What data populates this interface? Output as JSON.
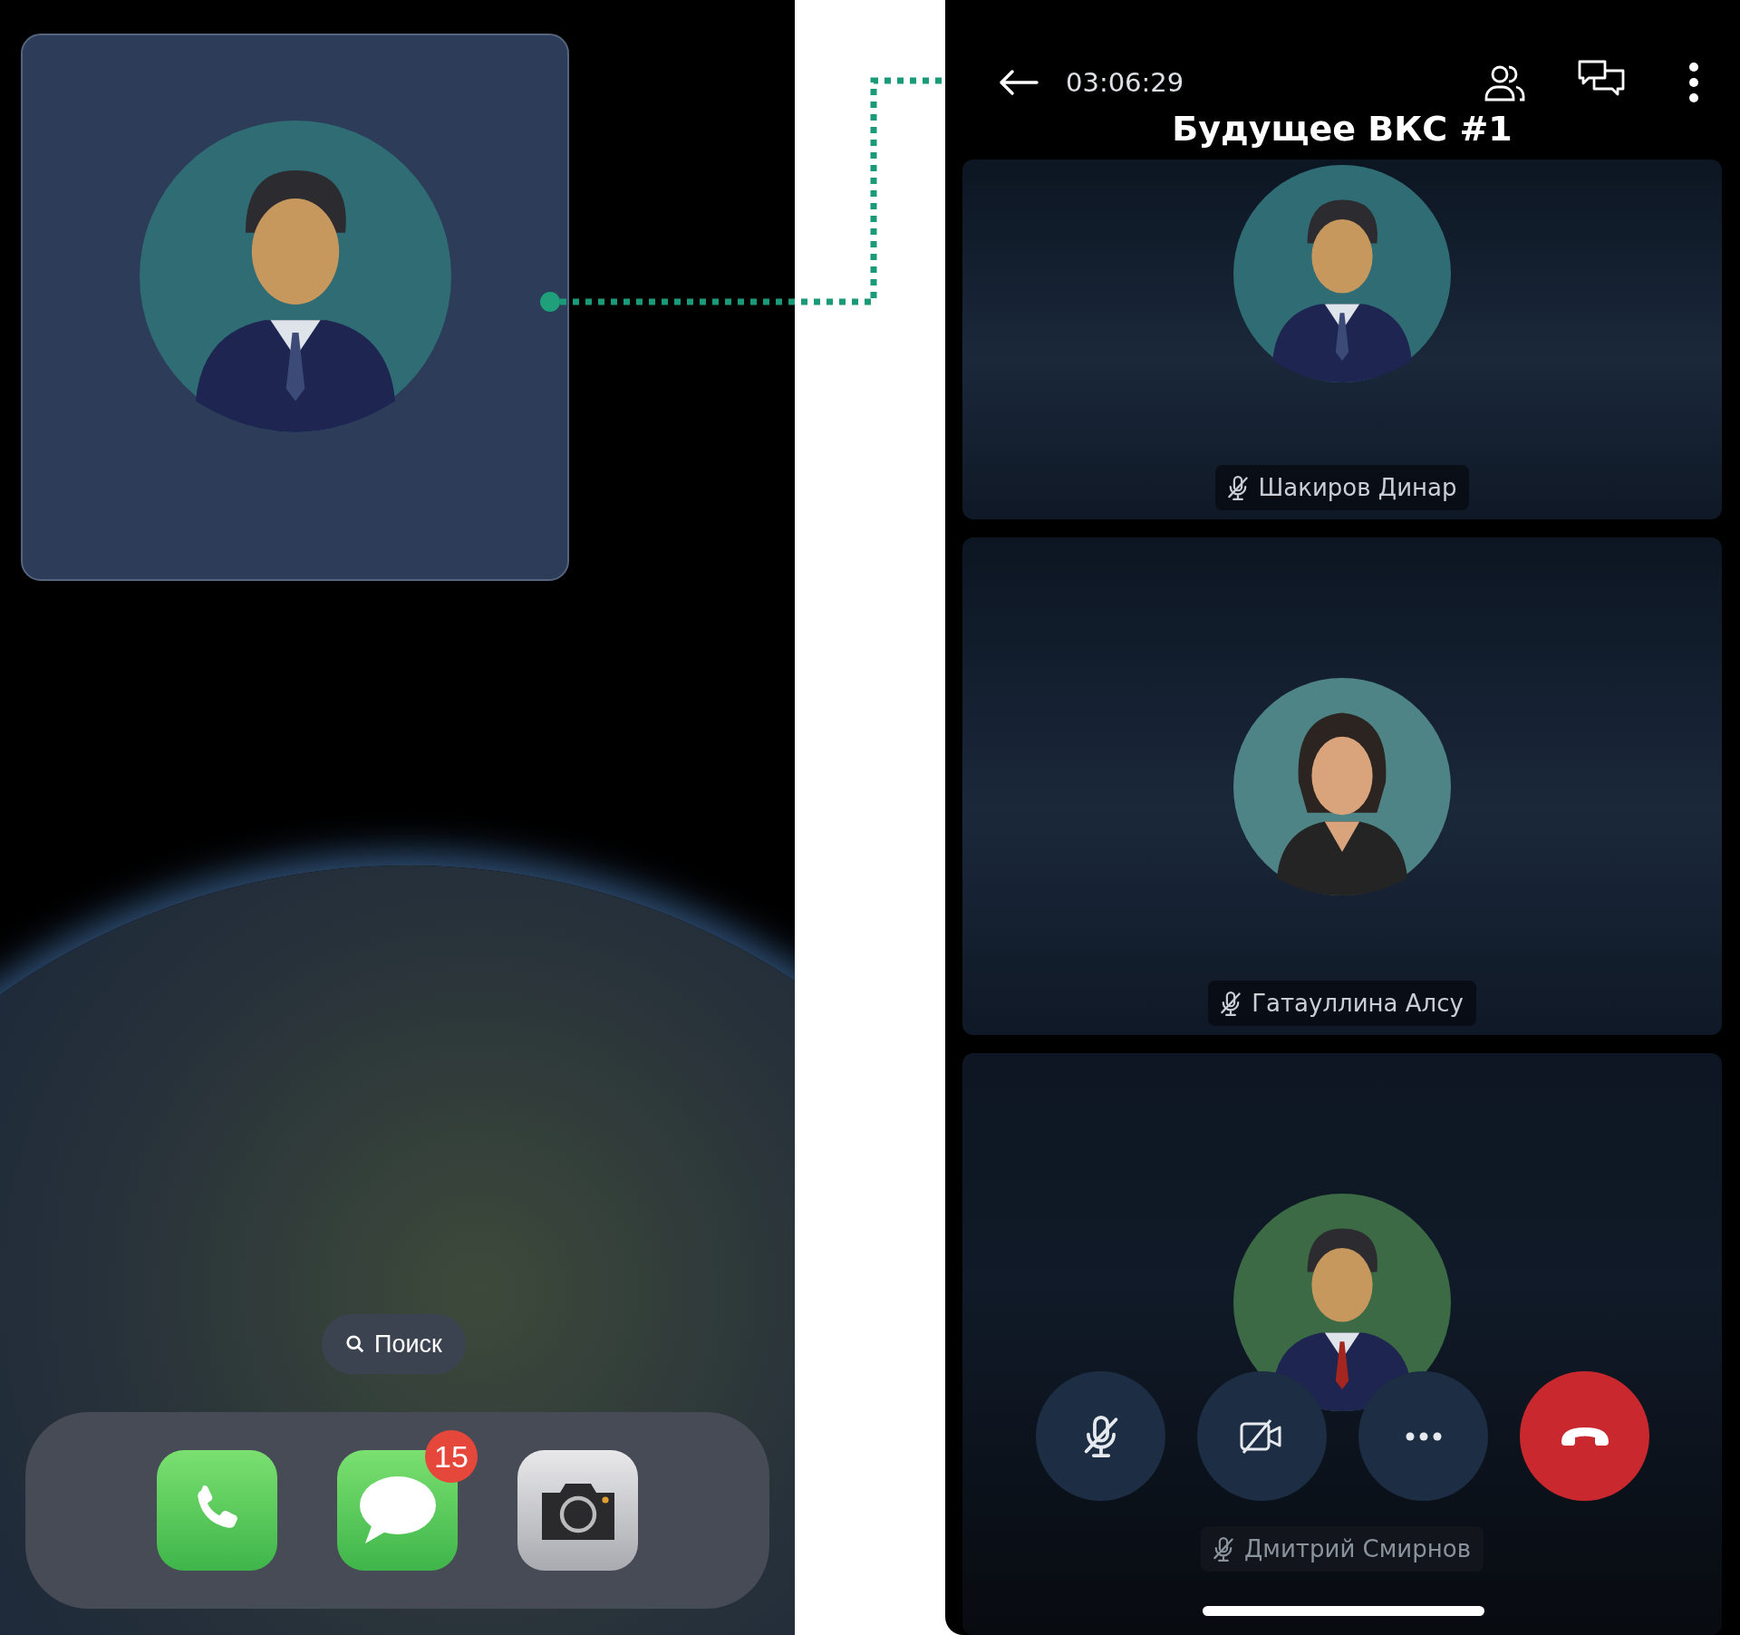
{
  "home_screen": {
    "search": {
      "label": "Поиск"
    },
    "dock": [
      {
        "kind": "phone"
      },
      {
        "kind": "messages",
        "badge": "15"
      },
      {
        "kind": "camera"
      }
    ]
  },
  "call": {
    "timer": "03:06:29",
    "title": "Будущее ВКС #1",
    "participants": [
      {
        "name": "Шакиров Динар",
        "muted": true,
        "kind": "man",
        "dimmed": false
      },
      {
        "name": "Гатауллина Алсу",
        "muted": true,
        "kind": "woman",
        "dimmed": false
      },
      {
        "name": "Дмитрий Смирнов",
        "muted": true,
        "kind": "man",
        "dimmed": true
      }
    ],
    "controls": [
      {
        "kind": "mic",
        "on": false
      },
      {
        "kind": "camera",
        "on": false
      },
      {
        "kind": "more"
      },
      {
        "kind": "hangup"
      }
    ]
  }
}
